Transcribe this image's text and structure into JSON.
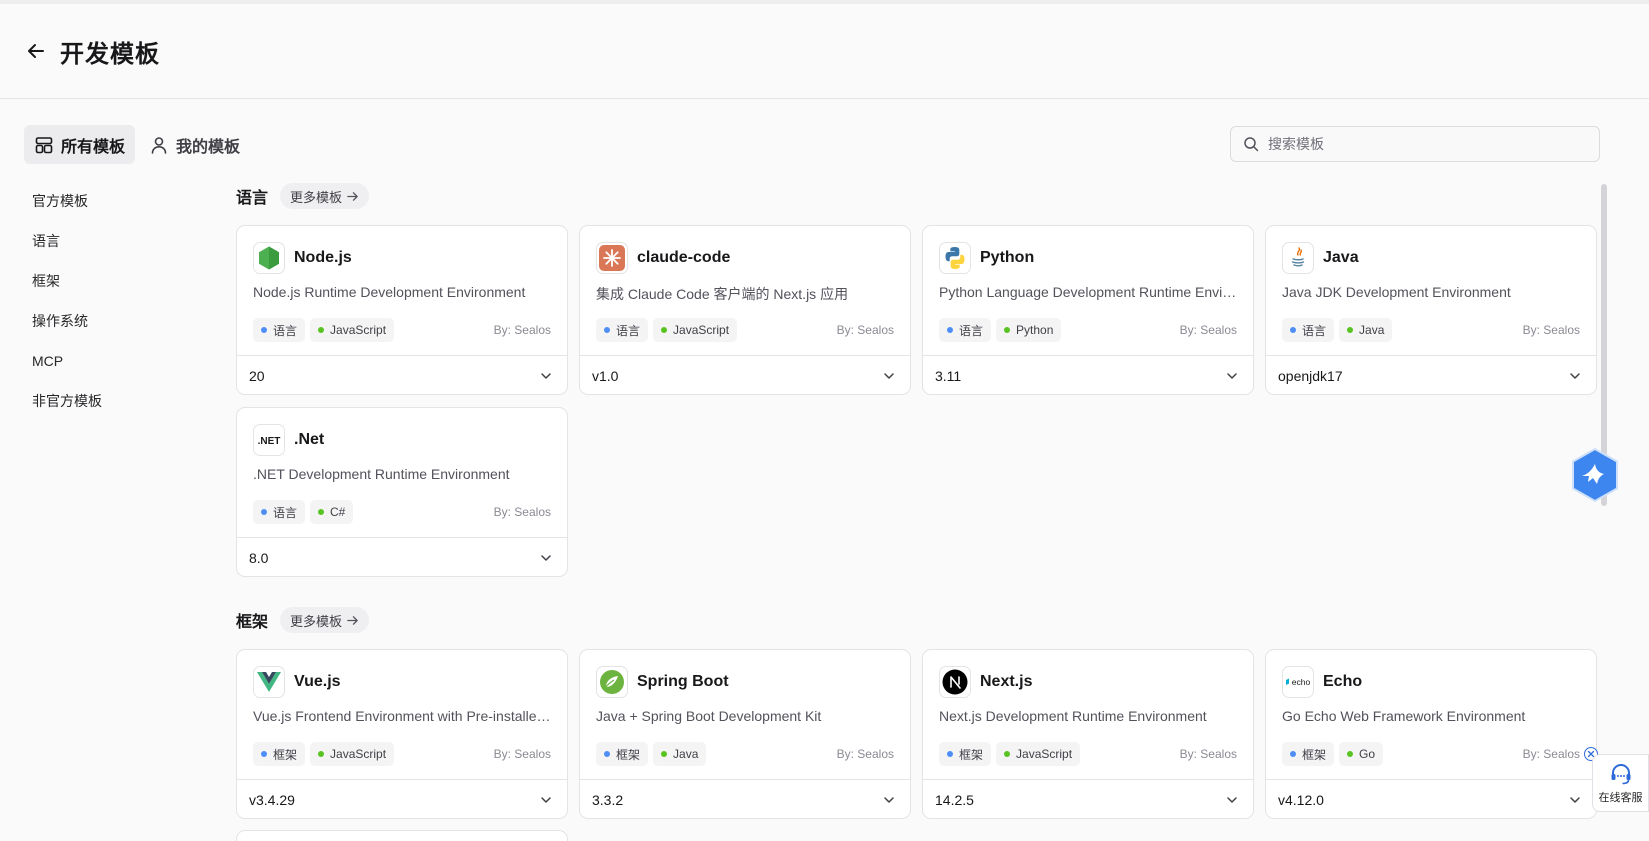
{
  "header": {
    "title": "开发模板"
  },
  "tabs": [
    {
      "label": "所有模板",
      "icon": "layout-icon",
      "active": true
    },
    {
      "label": "我的模板",
      "icon": "user-icon",
      "active": false
    }
  ],
  "search": {
    "placeholder": "搜索模板",
    "value": ""
  },
  "sidebar": {
    "items": [
      {
        "label": "官方模板"
      },
      {
        "label": "语言"
      },
      {
        "label": "框架"
      },
      {
        "label": "操作系统"
      },
      {
        "label": "MCP"
      },
      {
        "label": "非官方模板"
      }
    ]
  },
  "sections": [
    {
      "title": "语言",
      "more_label": "更多模板",
      "cards": [
        {
          "name": "Node.js",
          "description": "Node.js Runtime Development Environment",
          "category": "语言",
          "tech": "JavaScript",
          "author": "By: Sealos",
          "version": "20",
          "icon": "nodejs-icon"
        },
        {
          "name": "claude-code",
          "description": "集成 Claude Code 客户端的 Next.js 应用",
          "category": "语言",
          "tech": "JavaScript",
          "author": "By: Sealos",
          "version": "v1.0",
          "icon": "claude-icon"
        },
        {
          "name": "Python",
          "description": "Python Language Development Runtime Environment",
          "category": "语言",
          "tech": "Python",
          "author": "By: Sealos",
          "version": "3.11",
          "icon": "python-icon"
        },
        {
          "name": "Java",
          "description": "Java JDK Development Environment",
          "category": "语言",
          "tech": "Java",
          "author": "By: Sealos",
          "version": "openjdk17",
          "icon": "java-icon"
        },
        {
          "name": ".Net",
          "description": ".NET Development Runtime Environment",
          "category": "语言",
          "tech": "C#",
          "author": "By: Sealos",
          "version": "8.0",
          "icon": "dotnet-icon",
          "logo_text": ".NET"
        }
      ]
    },
    {
      "title": "框架",
      "more_label": "更多模板",
      "cards": [
        {
          "name": "Vue.js",
          "description": "Vue.js Frontend Environment with Pre-installed tools",
          "category": "框架",
          "tech": "JavaScript",
          "author": "By: Sealos",
          "version": "v3.4.29",
          "icon": "vue-icon"
        },
        {
          "name": "Spring Boot",
          "description": "Java + Spring Boot Development Kit",
          "category": "框架",
          "tech": "Java",
          "author": "By: Sealos",
          "version": "3.3.2",
          "icon": "spring-icon"
        },
        {
          "name": "Next.js",
          "description": "Next.js Development Runtime Environment",
          "category": "框架",
          "tech": "JavaScript",
          "author": "By: Sealos",
          "version": "14.2.5",
          "icon": "nextjs-icon"
        },
        {
          "name": "Echo",
          "description": "Go Echo Web Framework Environment",
          "category": "框架",
          "tech": "Go",
          "author": "By: Sealos",
          "version": "v4.12.0",
          "icon": "echo-icon",
          "logo_text": "echo"
        }
      ]
    }
  ],
  "support": {
    "label": "在线客服"
  },
  "colors": {
    "category_dot": "#4f8ef7",
    "tech_dot": "#58c322",
    "accent": "#2f6bd8"
  }
}
